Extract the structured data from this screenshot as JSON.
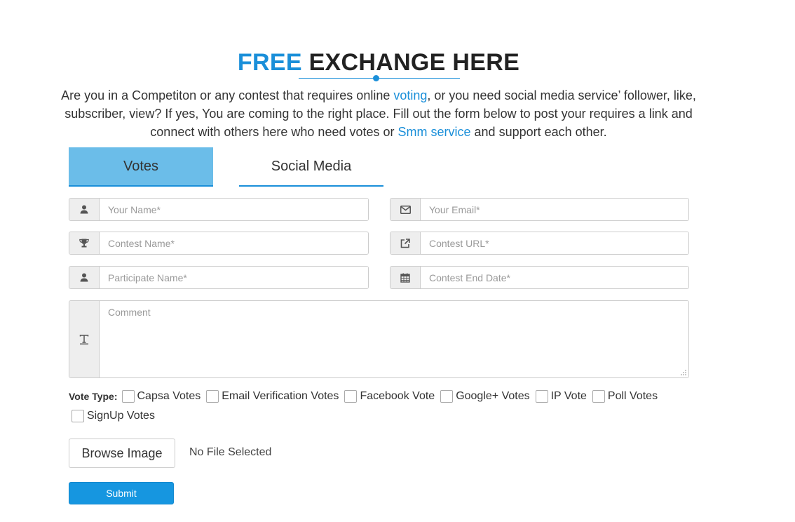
{
  "header": {
    "title_accent": "FREE",
    "title_rest": "EXCHANGE HERE",
    "accent_color": "#1a8fd9"
  },
  "intro": {
    "text_1": "Are you in a Competiton or any contest that requires online ",
    "link_voting": "voting",
    "text_2": ", or you need social media service’ follower, like, subscriber, view? If yes, You are coming to the right place. Fill out the form below to post your requires a link and connect with others here who need votes or ",
    "link_smm": "Smm service",
    "text_3": " and support each other."
  },
  "tabs": [
    {
      "label": "Votes",
      "active": true
    },
    {
      "label": "Social Media",
      "active": false
    }
  ],
  "form": {
    "your_name": {
      "placeholder": "Your Name*",
      "icon": "user-icon"
    },
    "your_email": {
      "placeholder": "Your Email*",
      "icon": "envelope-icon"
    },
    "contest_name": {
      "placeholder": "Contest Name*",
      "icon": "trophy-icon"
    },
    "contest_url": {
      "placeholder": "Contest URL*",
      "icon": "external-link-icon"
    },
    "participate_name": {
      "placeholder": "Participate Name*",
      "icon": "user-icon"
    },
    "contest_end_date": {
      "placeholder": "Contest End Date*",
      "icon": "calendar-icon"
    },
    "comment": {
      "placeholder": "Comment",
      "icon": "text-icon"
    }
  },
  "vote_type": {
    "label": "Vote Type:",
    "options": [
      "Capsa Votes",
      "Email Verification Votes",
      "Facebook Vote",
      "Google+ Votes",
      "IP Vote",
      "Poll Votes",
      "SignUp Votes"
    ]
  },
  "upload": {
    "button_label": "Browse Image",
    "status": "No File Selected"
  },
  "submit": {
    "label": "Submit",
    "color": "#1696e0"
  }
}
